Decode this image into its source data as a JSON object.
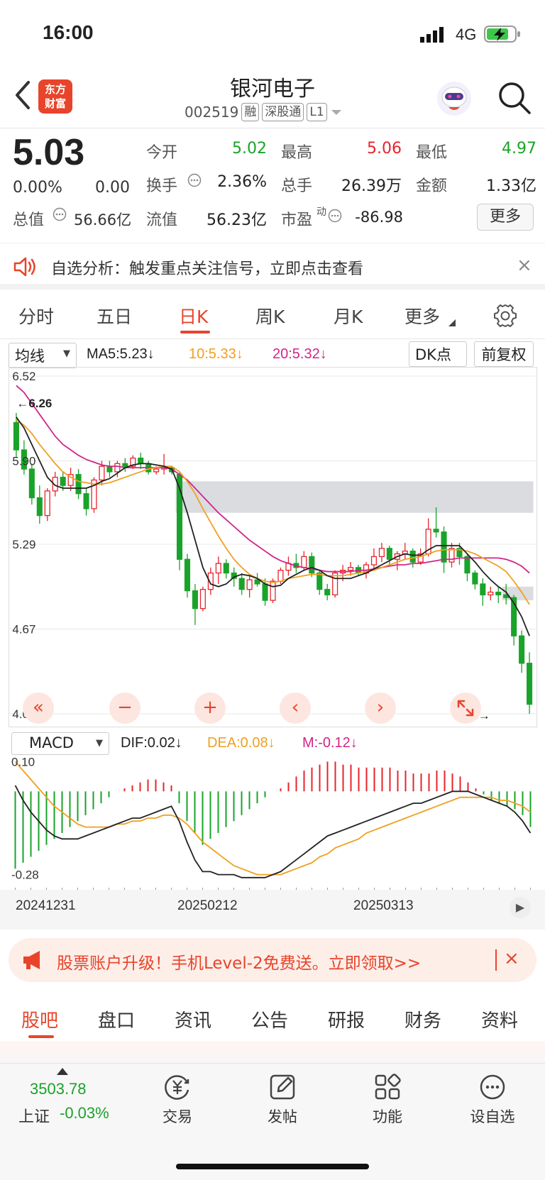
{
  "status": {
    "time": "16:00",
    "network": "4G"
  },
  "header": {
    "logo_line1": "东方",
    "logo_line2": "财富",
    "title": "银河电子",
    "code": "002519",
    "tags": [
      "融",
      "深股通",
      "L1"
    ]
  },
  "quote": {
    "price": "5.03",
    "pct": "0.00%",
    "change": "0.00",
    "mcap_label": "总值",
    "mcap": "56.66亿",
    "open_label": "今开",
    "open": "5.02",
    "high_label": "最高",
    "high": "5.06",
    "low_label": "最低",
    "low": "4.97",
    "turnover_label": "换手",
    "turnover": "2.36%",
    "volume_label": "总手",
    "volume": "26.39万",
    "amount_label": "金额",
    "amount": "1.33亿",
    "float_label": "流值",
    "float": "56.23亿",
    "pe_label": "市盈",
    "pe_sup": "动",
    "pe": "-86.98",
    "more": "更多"
  },
  "notice": {
    "text": "自选分析：触发重点关注信号，立即点击查看",
    "close": "×"
  },
  "tabs": [
    "分时",
    "五日",
    "日K",
    "周K",
    "月K",
    "更多"
  ],
  "indicator_bar": {
    "select": "均线",
    "ma5": "MA5:5.23↓",
    "ma10": "10:5.33↓",
    "ma20": "20:5.32↓",
    "dk": "DK点",
    "adjust": "前复权"
  },
  "colors": {
    "up": "#e8232b",
    "down": "#1aa32a",
    "ma5": "#222222",
    "ma10": "#f0a020",
    "ma20": "#d0258a",
    "accent": "#e8442b"
  },
  "chart_data": [
    {
      "type": "candlestick",
      "y_ticks": [
        "6.52",
        "5.90",
        "5.29",
        "4.67",
        "4.05"
      ],
      "ylim": [
        4.05,
        6.52
      ],
      "annotations": {
        "high_mark": "←6.26",
        "low_mark": "4.05→"
      },
      "x_labels": [
        "20241231",
        "20250212",
        "20250313"
      ],
      "candles": [
        [
          6.18,
          6.25,
          5.92,
          5.98
        ],
        [
          5.98,
          6.05,
          5.8,
          5.84
        ],
        [
          5.84,
          5.88,
          5.58,
          5.63
        ],
        [
          5.63,
          5.72,
          5.44,
          5.5
        ],
        [
          5.5,
          5.7,
          5.46,
          5.68
        ],
        [
          5.68,
          5.82,
          5.64,
          5.78
        ],
        [
          5.78,
          5.82,
          5.68,
          5.72
        ],
        [
          5.72,
          5.85,
          5.68,
          5.8
        ],
        [
          5.8,
          5.84,
          5.62,
          5.66
        ],
        [
          5.66,
          5.7,
          5.5,
          5.55
        ],
        [
          5.55,
          5.78,
          5.52,
          5.76
        ],
        [
          5.76,
          5.9,
          5.72,
          5.86
        ],
        [
          5.86,
          5.9,
          5.78,
          5.82
        ],
        [
          5.82,
          5.9,
          5.78,
          5.88
        ],
        [
          5.88,
          5.92,
          5.82,
          5.86
        ],
        [
          5.86,
          5.94,
          5.84,
          5.92
        ],
        [
          5.92,
          5.96,
          5.84,
          5.88
        ],
        [
          5.88,
          5.9,
          5.8,
          5.82
        ],
        [
          5.82,
          5.86,
          5.8,
          5.84
        ],
        [
          5.84,
          5.95,
          5.8,
          5.85
        ],
        [
          5.85,
          5.86,
          5.8,
          5.82
        ],
        [
          5.8,
          5.82,
          5.1,
          5.18
        ],
        [
          5.18,
          5.22,
          4.9,
          4.95
        ],
        [
          4.95,
          5.0,
          4.7,
          4.82
        ],
        [
          4.82,
          4.98,
          4.8,
          4.96
        ],
        [
          4.96,
          5.12,
          4.92,
          5.08
        ],
        [
          5.08,
          5.2,
          5.0,
          5.15
        ],
        [
          5.15,
          5.18,
          5.04,
          5.08
        ],
        [
          5.08,
          5.12,
          4.98,
          5.04
        ],
        [
          5.04,
          5.08,
          4.92,
          4.96
        ],
        [
          4.96,
          5.06,
          4.9,
          5.03
        ],
        [
          5.03,
          5.08,
          4.98,
          5.0
        ],
        [
          5.0,
          5.04,
          4.84,
          4.88
        ],
        [
          4.88,
          5.04,
          4.86,
          5.02
        ],
        [
          5.02,
          5.12,
          5.0,
          5.1
        ],
        [
          5.1,
          5.2,
          5.06,
          5.15
        ],
        [
          5.15,
          5.22,
          5.08,
          5.12
        ],
        [
          5.12,
          5.24,
          5.1,
          5.2
        ],
        [
          5.2,
          5.23,
          5.05,
          5.08
        ],
        [
          5.08,
          5.1,
          4.92,
          4.96
        ],
        [
          4.96,
          5.0,
          4.88,
          4.92
        ],
        [
          4.92,
          5.1,
          4.9,
          5.08
        ],
        [
          5.08,
          5.14,
          5.02,
          5.1
        ],
        [
          5.1,
          5.16,
          5.06,
          5.12
        ],
        [
          5.12,
          5.14,
          5.06,
          5.08
        ],
        [
          5.08,
          5.16,
          5.04,
          5.14
        ],
        [
          5.14,
          5.26,
          5.1,
          5.2
        ],
        [
          5.2,
          5.3,
          5.16,
          5.26
        ],
        [
          5.26,
          5.28,
          5.14,
          5.18
        ],
        [
          5.18,
          5.24,
          5.1,
          5.22
        ],
        [
          5.22,
          5.3,
          5.18,
          5.24
        ],
        [
          5.24,
          5.26,
          5.12,
          5.16
        ],
        [
          5.16,
          5.26,
          5.14,
          5.22
        ],
        [
          5.22,
          5.48,
          5.2,
          5.4
        ],
        [
          5.4,
          5.56,
          5.34,
          5.38
        ],
        [
          5.38,
          5.42,
          5.08,
          5.16
        ],
        [
          5.16,
          5.3,
          5.12,
          5.26
        ],
        [
          5.26,
          5.3,
          5.14,
          5.2
        ],
        [
          5.2,
          5.22,
          5.02,
          5.08
        ],
        [
          5.08,
          5.1,
          4.96,
          5.0
        ],
        [
          5.0,
          5.04,
          4.84,
          4.92
        ],
        [
          4.92,
          4.98,
          4.88,
          4.94
        ],
        [
          4.94,
          4.98,
          4.86,
          4.92
        ],
        [
          4.92,
          5.0,
          4.85,
          4.9
        ],
        [
          4.9,
          4.92,
          4.55,
          4.62
        ],
        [
          4.62,
          4.66,
          4.35,
          4.42
        ],
        [
          4.42,
          4.5,
          4.05,
          4.12
        ]
      ],
      "ma5": [
        6.22,
        6.14,
        6.02,
        5.9,
        5.78,
        5.72,
        5.7,
        5.7,
        5.7,
        5.7,
        5.72,
        5.75,
        5.77,
        5.81,
        5.85,
        5.87,
        5.88,
        5.88,
        5.87,
        5.86,
        5.84,
        5.7,
        5.52,
        5.32,
        5.12,
        5.0,
        4.98,
        5.0,
        5.05,
        5.07,
        5.06,
        5.04,
        5.0,
        4.98,
        4.99,
        5.04,
        5.07,
        5.1,
        5.12,
        5.1,
        5.06,
        5.04,
        5.04,
        5.04,
        5.06,
        5.08,
        5.11,
        5.14,
        5.17,
        5.2,
        5.22,
        5.21,
        5.21,
        5.25,
        5.28,
        5.28,
        5.28,
        5.28,
        5.22,
        5.16,
        5.09,
        5.03,
        4.98,
        4.94,
        4.86,
        4.76,
        4.62
      ],
      "ma10": [
        6.2,
        6.16,
        6.1,
        6.02,
        5.95,
        5.88,
        5.82,
        5.78,
        5.75,
        5.74,
        5.73,
        5.73,
        5.74,
        5.76,
        5.78,
        5.8,
        5.82,
        5.84,
        5.85,
        5.86,
        5.86,
        5.82,
        5.75,
        5.66,
        5.55,
        5.45,
        5.35,
        5.26,
        5.18,
        5.12,
        5.07,
        5.04,
        5.02,
        5.01,
        5.02,
        5.04,
        5.05,
        5.06,
        5.07,
        5.07,
        5.06,
        5.06,
        5.06,
        5.07,
        5.08,
        5.09,
        5.1,
        5.12,
        5.14,
        5.16,
        5.18,
        5.19,
        5.2,
        5.22,
        5.24,
        5.25,
        5.25,
        5.25,
        5.24,
        5.22,
        5.19,
        5.16,
        5.13,
        5.09,
        5.02,
        4.94,
        4.85
      ],
      "ma20": [
        6.45,
        6.4,
        6.32,
        6.24,
        6.16,
        6.08,
        6.02,
        5.98,
        5.94,
        5.91,
        5.89,
        5.87,
        5.86,
        5.86,
        5.85,
        5.85,
        5.85,
        5.85,
        5.85,
        5.85,
        5.84,
        5.8,
        5.76,
        5.7,
        5.64,
        5.58,
        5.52,
        5.47,
        5.42,
        5.37,
        5.32,
        5.28,
        5.24,
        5.2,
        5.17,
        5.15,
        5.13,
        5.12,
        5.11,
        5.1,
        5.09,
        5.09,
        5.09,
        5.09,
        5.1,
        5.1,
        5.11,
        5.12,
        5.13,
        5.14,
        5.14,
        5.15,
        5.15,
        5.16,
        5.17,
        5.18,
        5.18,
        5.19,
        5.19,
        5.19,
        5.19,
        5.19,
        5.19,
        5.18,
        5.16,
        5.13,
        5.08
      ],
      "gaps": [
        {
          "top": 5.75,
          "bottom": 5.52,
          "from_index": 21
        },
        {
          "top": 4.98,
          "bottom": 4.88,
          "from_index": 63
        }
      ]
    },
    {
      "type": "bar",
      "indicator_select": "MACD",
      "dif_label": "DIF:0.02↓",
      "dea_label": "DEA:0.08↓",
      "m_label": "M:-0.12↓",
      "y_ticks": [
        "0.10",
        "-0.28"
      ],
      "ylim": [
        -0.3,
        0.12
      ],
      "hist": [
        -0.26,
        -0.24,
        -0.22,
        -0.2,
        -0.18,
        -0.16,
        -0.14,
        -0.12,
        -0.1,
        -0.08,
        -0.06,
        -0.04,
        -0.02,
        0.0,
        0.01,
        0.02,
        0.03,
        0.04,
        0.04,
        0.03,
        0.02,
        -0.04,
        -0.1,
        -0.14,
        -0.18,
        -0.16,
        -0.14,
        -0.12,
        -0.1,
        -0.08,
        -0.06,
        -0.04,
        -0.02,
        0.0,
        0.01,
        0.03,
        0.05,
        0.07,
        0.08,
        0.09,
        0.1,
        0.1,
        0.09,
        0.09,
        0.08,
        0.08,
        0.08,
        0.08,
        0.08,
        0.07,
        0.07,
        0.06,
        0.06,
        0.06,
        0.07,
        0.07,
        0.06,
        0.05,
        0.03,
        0.01,
        -0.01,
        -0.03,
        -0.04,
        -0.05,
        -0.06,
        -0.08,
        -0.12
      ],
      "dif": [
        0.02,
        -0.03,
        -0.07,
        -0.1,
        -0.13,
        -0.15,
        -0.16,
        -0.16,
        -0.16,
        -0.15,
        -0.14,
        -0.13,
        -0.12,
        -0.11,
        -0.1,
        -0.09,
        -0.09,
        -0.08,
        -0.07,
        -0.06,
        -0.05,
        -0.1,
        -0.17,
        -0.23,
        -0.27,
        -0.27,
        -0.28,
        -0.28,
        -0.28,
        -0.29,
        -0.29,
        -0.29,
        -0.29,
        -0.28,
        -0.27,
        -0.25,
        -0.23,
        -0.21,
        -0.19,
        -0.17,
        -0.15,
        -0.14,
        -0.13,
        -0.12,
        -0.11,
        -0.1,
        -0.09,
        -0.08,
        -0.07,
        -0.06,
        -0.05,
        -0.04,
        -0.04,
        -0.03,
        -0.02,
        -0.01,
        0.0,
        0.0,
        0.0,
        -0.01,
        -0.02,
        -0.03,
        -0.04,
        -0.05,
        -0.07,
        -0.1,
        -0.14
      ],
      "dea": [
        0.1,
        0.07,
        0.04,
        0.01,
        -0.02,
        -0.05,
        -0.07,
        -0.09,
        -0.11,
        -0.12,
        -0.12,
        -0.12,
        -0.12,
        -0.11,
        -0.11,
        -0.1,
        -0.1,
        -0.09,
        -0.09,
        -0.08,
        -0.08,
        -0.09,
        -0.11,
        -0.14,
        -0.17,
        -0.19,
        -0.21,
        -0.23,
        -0.25,
        -0.26,
        -0.27,
        -0.28,
        -0.28,
        -0.28,
        -0.28,
        -0.27,
        -0.26,
        -0.25,
        -0.24,
        -0.22,
        -0.21,
        -0.19,
        -0.18,
        -0.17,
        -0.16,
        -0.14,
        -0.13,
        -0.12,
        -0.11,
        -0.1,
        -0.09,
        -0.08,
        -0.07,
        -0.06,
        -0.05,
        -0.04,
        -0.03,
        -0.02,
        -0.02,
        -0.02,
        -0.02,
        -0.02,
        -0.03,
        -0.03,
        -0.04,
        -0.05,
        -0.07
      ]
    }
  ],
  "chart_controls": [
    "«",
    "−",
    "+",
    "‹",
    "›"
  ],
  "banner": {
    "text": "股票账户升级！手机Level-2免费送。立即领取>>",
    "close": "×"
  },
  "subtabs": [
    "股吧",
    "盘口",
    "资讯",
    "公告",
    "研报",
    "财务",
    "资料"
  ],
  "bottom": {
    "index_value": "3503.78",
    "index_name": "上证",
    "index_pct": "-0.03%",
    "nav": [
      "交易",
      "发帖",
      "功能",
      "设自选"
    ]
  }
}
